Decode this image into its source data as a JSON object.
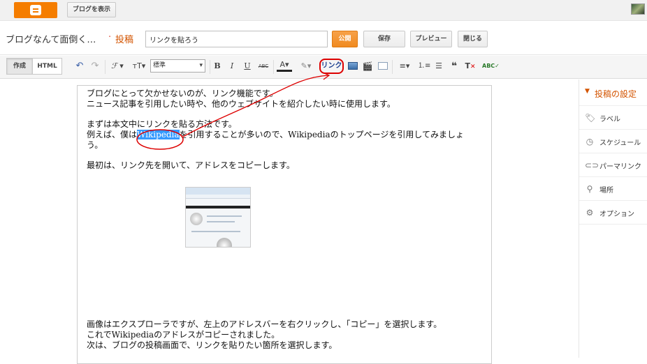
{
  "topbar": {
    "view_blog_label": "ブログを表示"
  },
  "header": {
    "blog_title": "ブログなんて面倒く…",
    "separator": "·",
    "post_type": "投稿",
    "title_value": "リンクを貼ろう",
    "publish_label": "公開",
    "save_label": "保存",
    "preview_label": "プレビュー",
    "close_label": "閉じる"
  },
  "toolbar": {
    "compose_label": "作成",
    "html_label": "HTML",
    "font_size_value": "標準",
    "link_label": "リンク"
  },
  "content": {
    "p1_line1": "ブログにとって欠かせないのが、リンク機能です。",
    "p1_line2": "ニュース記事を引用したい時や、他のウェブサイトを紹介したい時に使用します。",
    "p2_line1": "まずは本文中にリンクを貼る方法です。",
    "p2_line2_pre": "例えば、僕は",
    "p2_highlight": "Wikipedia",
    "p2_line2_post": "を引用することが多いので、Wikipediaのトップページを引用してみましょ",
    "p2_line3": "う。",
    "p3_line1": "最初は、リンク先を開いて、アドレスをコピーします。",
    "p4_line1": "画像はエクスプローラですが、左上のアドレスバーを右クリックし、「コピー」を選択します。",
    "p4_line2": "これでWikipediaのアドレスがコピーされました。",
    "p4_line3": "次は、ブログの投稿画面で、リンクを貼りたい箇所を選択します。"
  },
  "sidebar": {
    "header": "投稿の設定",
    "items": [
      {
        "label": "ラベル",
        "icon": "tag-icon"
      },
      {
        "label": "スケジュール",
        "icon": "clock-icon"
      },
      {
        "label": "パーマリンク",
        "icon": "link-icon"
      },
      {
        "label": "場所",
        "icon": "pin-icon"
      },
      {
        "label": "オプション",
        "icon": "gear-icon"
      }
    ]
  },
  "colors": {
    "accent": "#f57d00",
    "annotation": "#d00000",
    "highlight": "#3399ff"
  }
}
